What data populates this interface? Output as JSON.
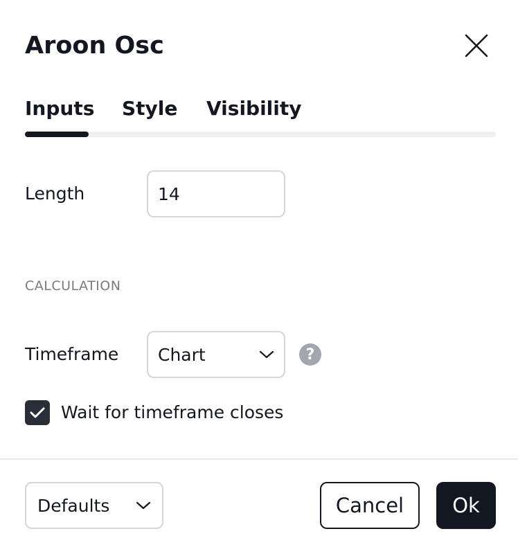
{
  "dialog": {
    "title": "Aroon Osc",
    "close_icon": "close-icon"
  },
  "tabs": [
    {
      "label": "Inputs",
      "active": true
    },
    {
      "label": "Style",
      "active": false
    },
    {
      "label": "Visibility",
      "active": false
    }
  ],
  "inputs": {
    "length": {
      "label": "Length",
      "value": "14"
    },
    "section_header": "CALCULATION",
    "timeframe": {
      "label": "Timeframe",
      "value": "Chart",
      "help_icon": "question-circle-icon"
    },
    "wait_closes": {
      "label": "Wait for timeframe closes",
      "checked": true
    }
  },
  "footer": {
    "defaults_label": "Defaults",
    "cancel_label": "Cancel",
    "ok_label": "Ok"
  },
  "colors": {
    "text": "#131722",
    "accent": "#131722",
    "border": "#d4d6dc",
    "muted": "#787b86",
    "help_bg": "#a3a6af"
  }
}
